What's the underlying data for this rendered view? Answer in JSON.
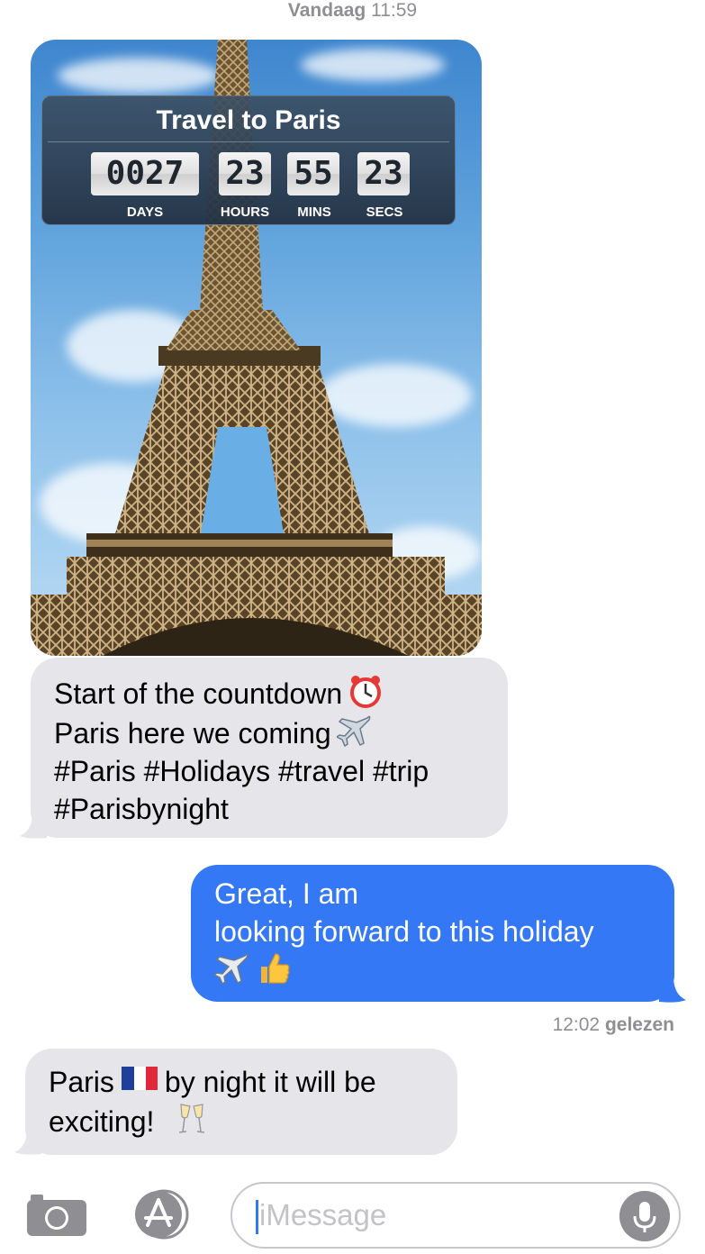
{
  "header": {
    "day": "Vandaag",
    "time": "11:59"
  },
  "photo": {
    "widget_title": "Travel to Paris",
    "days": "0027",
    "hours": "23",
    "mins": "55",
    "secs": "23",
    "label_days": "DAYS",
    "label_hours": "HOURS",
    "label_mins": "MINS",
    "label_secs": "SECS"
  },
  "messages": [
    {
      "direction": "incoming",
      "lines": [
        "Start of the countdown",
        "Paris here we coming",
        "#Paris #Holidays #travel #trip",
        "#Parisbynight"
      ],
      "emojis": [
        "alarm-clock",
        "airplane"
      ]
    },
    {
      "direction": "outgoing",
      "lines": [
        "Great, I am",
        "looking forward to this holiday"
      ],
      "emojis": [
        "airplane",
        "thumbs-up"
      ]
    },
    {
      "direction": "incoming",
      "lines": [
        "Paris",
        "by night it will be",
        "exciting!"
      ],
      "emojis": [
        "france-flag",
        "champagne-glasses"
      ]
    }
  ],
  "receipt": {
    "time": "12:02",
    "status": "gelezen"
  },
  "composer": {
    "placeholder": "iMessage"
  },
  "colors": {
    "outgoing": "#3478f6",
    "incoming": "#e5e5ea",
    "meta": "#8e8e93"
  }
}
